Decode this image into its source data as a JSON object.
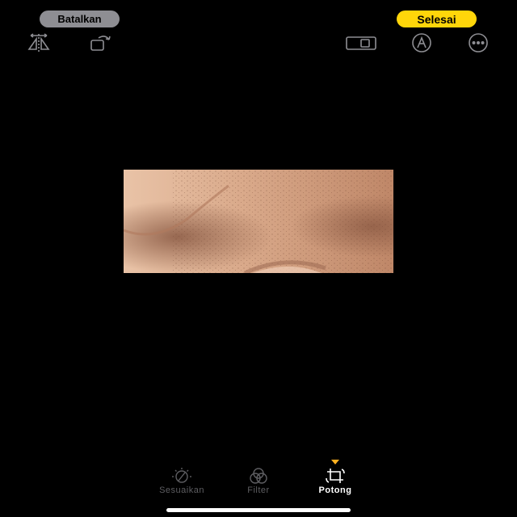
{
  "header": {
    "cancel_label": "Batalkan",
    "done_label": "Selesai"
  },
  "toolbar_top": {
    "left_icons": [
      "flip-horizontal-icon",
      "rotate-icon"
    ],
    "right_icons": [
      "aspect-ratio-icon",
      "markup-icon",
      "more-icon"
    ]
  },
  "editor": {
    "active_tool": "Potong"
  },
  "tools": [
    {
      "label": "Sesuaikan",
      "icon": "adjust-dial-icon",
      "active": false
    },
    {
      "label": "Filter",
      "icon": "filter-circles-icon",
      "active": false
    },
    {
      "label": "Potong",
      "icon": "crop-rotate-icon",
      "active": true
    }
  ],
  "colors": {
    "accent": "#ffd60a",
    "active_marker": "#ffb020",
    "inactive_text": "#5e5e62",
    "background": "#000000"
  }
}
